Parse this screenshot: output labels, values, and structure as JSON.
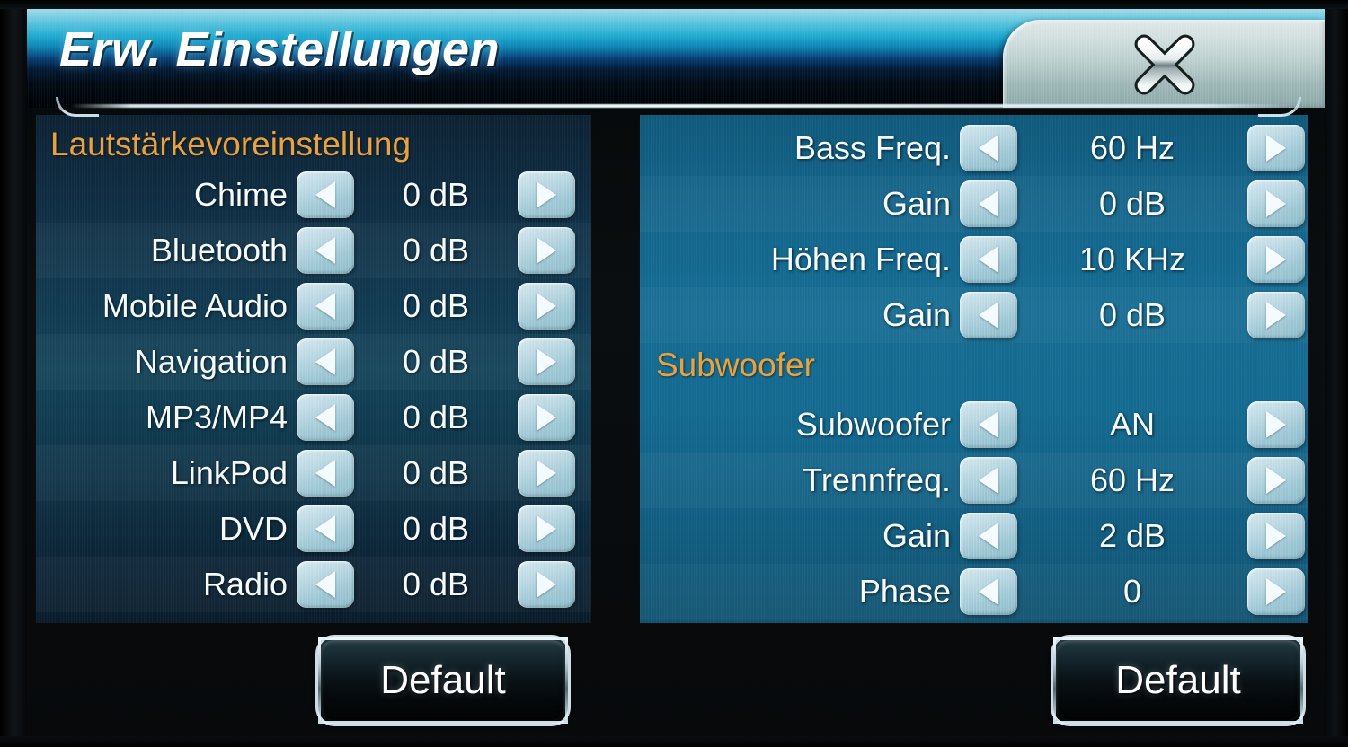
{
  "header": {
    "title": "Erw. Einstellungen",
    "close_icon": "close-x-icon"
  },
  "colors": {
    "accent_orange": "#e9a13d",
    "panel_left_bg": "#124258",
    "panel_right_bg": "#156c93",
    "header_cyan": "#1ba7cd",
    "text_white": "#f4fbff"
  },
  "left_panel": {
    "section_title": "Lautstärkevoreinstellung",
    "rows": [
      {
        "label": "Chime",
        "value": "0 dB",
        "dec_icon": "arrow-left-icon",
        "inc_icon": "arrow-right-icon"
      },
      {
        "label": "Bluetooth",
        "value": "0 dB",
        "dec_icon": "arrow-left-icon",
        "inc_icon": "arrow-right-icon"
      },
      {
        "label": "Mobile Audio",
        "value": "0 dB",
        "dec_icon": "arrow-left-icon",
        "inc_icon": "arrow-right-icon"
      },
      {
        "label": "Navigation",
        "value": "0 dB",
        "dec_icon": "arrow-left-icon",
        "inc_icon": "arrow-right-icon"
      },
      {
        "label": "MP3/MP4",
        "value": "0 dB",
        "dec_icon": "arrow-left-icon",
        "inc_icon": "arrow-right-icon"
      },
      {
        "label": "LinkPod",
        "value": "0 dB",
        "dec_icon": "arrow-left-icon",
        "inc_icon": "arrow-right-icon"
      },
      {
        "label": "DVD",
        "value": "0 dB",
        "dec_icon": "arrow-left-icon",
        "inc_icon": "arrow-right-icon"
      },
      {
        "label": "Radio",
        "value": "0 dB",
        "dec_icon": "arrow-left-icon",
        "inc_icon": "arrow-right-icon"
      }
    ],
    "default_button": "Default"
  },
  "right_panel": {
    "eq_rows": [
      {
        "label": "Bass Freq.",
        "value": "60 Hz",
        "dec_icon": "arrow-left-icon",
        "inc_icon": "arrow-right-icon"
      },
      {
        "label": "Gain",
        "value": "0 dB",
        "dec_icon": "arrow-left-icon",
        "inc_icon": "arrow-right-icon"
      },
      {
        "label": "Höhen Freq.",
        "value": "10 KHz",
        "dec_icon": "arrow-left-icon",
        "inc_icon": "arrow-right-icon"
      },
      {
        "label": "Gain",
        "value": "0 dB",
        "dec_icon": "arrow-left-icon",
        "inc_icon": "arrow-right-icon"
      }
    ],
    "section_title": "Subwoofer",
    "sub_rows": [
      {
        "label": "Subwoofer",
        "value": "AN",
        "dec_icon": "arrow-left-icon",
        "inc_icon": "arrow-right-icon"
      },
      {
        "label": "Trennfreq.",
        "value": "60 Hz",
        "dec_icon": "arrow-left-icon",
        "inc_icon": "arrow-right-icon"
      },
      {
        "label": "Gain",
        "value": "2 dB",
        "dec_icon": "arrow-left-icon",
        "inc_icon": "arrow-right-icon"
      },
      {
        "label": "Phase",
        "value": "0",
        "dec_icon": "arrow-left-icon",
        "inc_icon": "arrow-right-icon"
      }
    ],
    "default_button": "Default"
  }
}
